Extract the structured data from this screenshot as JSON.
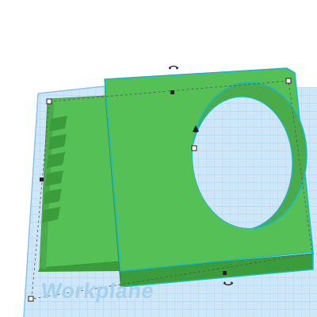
{
  "workplane": {
    "label": "Workplane"
  },
  "colors": {
    "workplane_fill": "#cfe6f6",
    "grid_line": "#a8d2ee",
    "grid_major": "#8cc2e8",
    "shape_top": "#55c055",
    "shape_side": "#3a9c3a",
    "shape_edge": "#2e8a2e",
    "selection_outline": "#1ab7c9",
    "hole_wall": "#4aab4a",
    "hole_floor": "#cfe6f6",
    "handle_fill": "#ffffff",
    "handle_stroke": "#222222"
  },
  "icons": {
    "rotate_top": "rotate-arrow-icon",
    "rotate_bottom": "rotate-arrow-icon",
    "lift_cone": "lift-cone-icon"
  }
}
